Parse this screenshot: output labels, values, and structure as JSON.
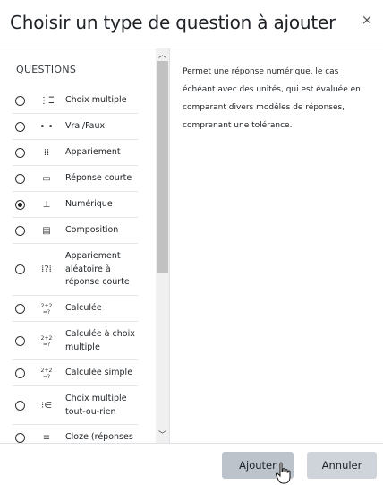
{
  "dialog": {
    "title": "Choisir un type de question à ajouter",
    "close_glyph": "×"
  },
  "list": {
    "section_label": "QUESTIONS",
    "items": [
      {
        "label": "Choix multiple",
        "icon": "multichoice-icon",
        "glyph": "⋮☰",
        "selected": false
      },
      {
        "label": "Vrai/Faux",
        "icon": "truefalse-icon",
        "glyph": "• •",
        "selected": false
      },
      {
        "label": "Appariement",
        "icon": "matching-icon",
        "glyph": "⁞⁞",
        "selected": false
      },
      {
        "label": "Réponse courte",
        "icon": "shortanswer-icon",
        "glyph": "▭",
        "selected": false
      },
      {
        "label": "Numérique",
        "icon": "numerical-icon",
        "glyph": "⊥",
        "selected": true
      },
      {
        "label": "Composition",
        "icon": "essay-icon",
        "glyph": "▤",
        "selected": false
      },
      {
        "label": "Appariement aléatoire à réponse courte",
        "icon": "randomsamatch-icon",
        "glyph": "⁞?⁞",
        "selected": false
      },
      {
        "label": "Calculée",
        "icon": "calculated-icon",
        "glyph": "2+2\n=?",
        "selected": false
      },
      {
        "label": "Calculée à choix multiple",
        "icon": "calculatedmulti-icon",
        "glyph": "2+2\n=?",
        "selected": false
      },
      {
        "label": "Calculée simple",
        "icon": "calculatedsimple-icon",
        "glyph": "2+2\n=?",
        "selected": false
      },
      {
        "label": "Choix multiple tout-ou-rien",
        "icon": "oumultiresponse-icon",
        "glyph": "⁝∈",
        "selected": false
      },
      {
        "label": "Cloze (réponses",
        "icon": "multianswer-icon",
        "glyph": "≡",
        "selected": false
      }
    ]
  },
  "description": {
    "text": "Permet une réponse numérique, le cas échéant avec des unités, qui est évaluée en comparant divers modèles de réponses, comprenant une tolérance."
  },
  "footer": {
    "add_label": "Ajouter",
    "cancel_label": "Annuler"
  },
  "scrollbar": {
    "up_glyph": "︿",
    "down_glyph": "﹀"
  }
}
